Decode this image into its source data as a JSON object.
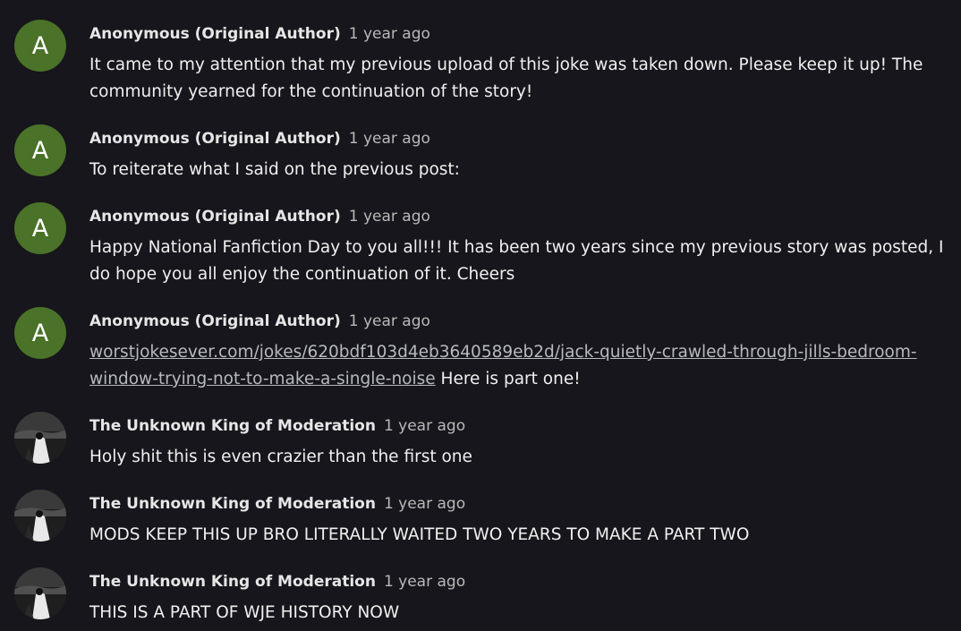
{
  "comments": [
    {
      "avatar_letter": "A",
      "author": "Anonymous (Original Author)",
      "time": "1 year ago",
      "text": "It came to my attention that my previous upload of this joke was taken down. Please keep it up! The community yearned for the continuation of the story!"
    },
    {
      "avatar_letter": "A",
      "author": "Anonymous (Original Author)",
      "time": "1 year ago",
      "text": "To reiterate what I said on the previous post:"
    },
    {
      "avatar_letter": "A",
      "author": "Anonymous (Original Author)",
      "time": "1 year ago",
      "text": "Happy National Fanfiction Day to you all!!! It has been two years since my previous story was posted, I do hope you all enjoy the continuation of it. Cheers"
    },
    {
      "avatar_letter": "A",
      "author": "Anonymous (Original Author)",
      "time": "1 year ago",
      "link": "worstjokesever.com/jokes/620bdf103d4eb3640589eb2d/jack-quietly-crawled-through-jills-bedroom-window-trying-not-to-make-a-single-noise",
      "text": " Here is part one!"
    },
    {
      "author": "The Unknown King of Moderation",
      "time": "1 year ago",
      "text": "Holy shit this is even crazier than the first one"
    },
    {
      "author": "The Unknown King of Moderation",
      "time": "1 year ago",
      "text": "MODS KEEP THIS UP BRO LITERALLY WAITED TWO YEARS TO MAKE A PART TWO"
    },
    {
      "author": "The Unknown King of Moderation",
      "time": "1 year ago",
      "text": "THIS IS A PART OF WJE HISTORY NOW"
    }
  ],
  "colors": {
    "background": "#16161c",
    "avatar_green": "#4a7228",
    "text": "#f0f0f0",
    "muted": "#b9b9b9"
  }
}
